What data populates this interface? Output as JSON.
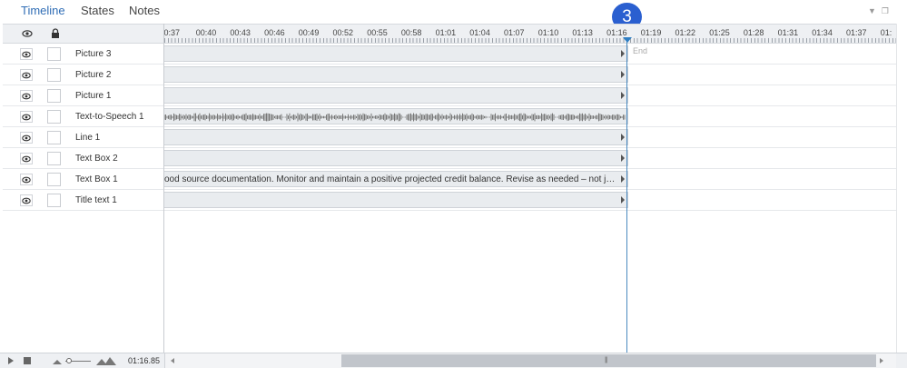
{
  "tabs": [
    {
      "label": "Timeline",
      "active": true
    },
    {
      "label": "States",
      "active": false
    },
    {
      "label": "Notes",
      "active": false
    }
  ],
  "header_icons": [
    "dropdown-arrow-icon",
    "restore-window-icon"
  ],
  "columns": {
    "visibility_icon": "eye-icon",
    "lock_icon": "lock-icon"
  },
  "layers": [
    {
      "name": "Picture 3",
      "bar_text": ""
    },
    {
      "name": "Picture 2",
      "bar_text": ""
    },
    {
      "name": "Picture 1",
      "bar_text": ""
    },
    {
      "name": "Text-to-Speech 1",
      "bar_text": "",
      "waveform": true
    },
    {
      "name": "Line 1",
      "bar_text": ""
    },
    {
      "name": "Text Box 2",
      "bar_text": ""
    },
    {
      "name": "Text Box 1",
      "bar_text": "ood source documentation. Monitor and maintain a positive projected credit balance. Revise as needed – not just mon..."
    },
    {
      "name": "Title text 1",
      "bar_text": ""
    }
  ],
  "ruler": {
    "labels": [
      ":0:37",
      "00:40",
      "00:43",
      "00:46",
      "00:49",
      "00:52",
      "00:55",
      "00:58",
      "01:01",
      "01:04",
      "01:07",
      "01:10",
      "01:13",
      "01:16",
      "01:19",
      "01:22",
      "01:25",
      "01:28",
      "01:31",
      "01:34",
      "01:37",
      "01:"
    ]
  },
  "end_label": "End",
  "callout_badge": "3",
  "playback": {
    "current_time": "01:16.85"
  },
  "colors": {
    "accent": "#2f6db5",
    "badge": "#2a5fd0",
    "playhead": "#4a8ac0"
  }
}
